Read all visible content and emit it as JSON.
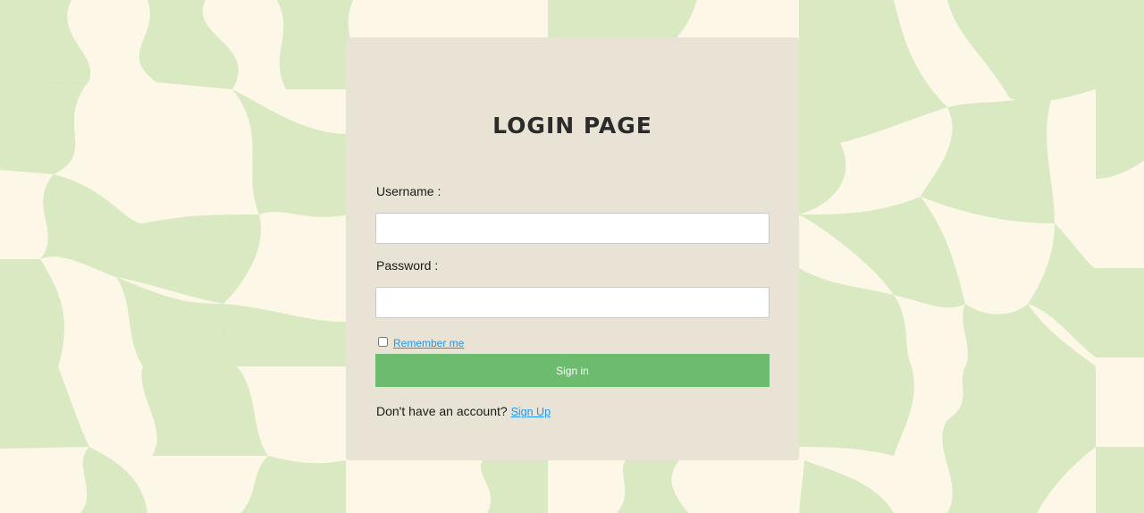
{
  "colors": {
    "background_cream": "#fcf7e6",
    "background_green": "#d9eac3",
    "card": "#e8e3d4",
    "button": "#6dbb6e",
    "link": "#2196f3"
  },
  "login": {
    "title": "LOGIN PAGE",
    "username_label": "Username :",
    "username_value": "",
    "password_label": "Password :",
    "password_value": "",
    "remember_label": "Remember me",
    "remember_checked": false,
    "signin_label": "Sign in",
    "no_account_text": "Don't have an account?",
    "signup_link": "Sign Up"
  }
}
